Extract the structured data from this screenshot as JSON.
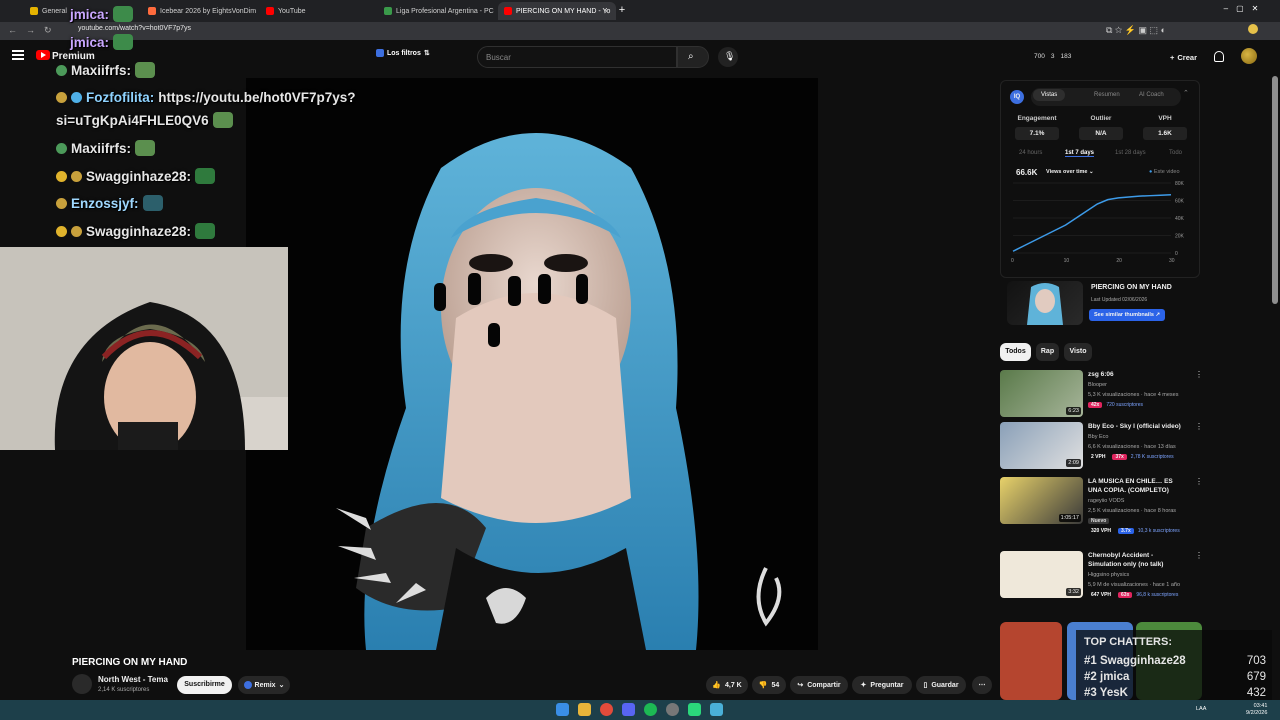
{
  "browser": {
    "tabs": [
      {
        "label": "General",
        "active": false
      },
      {
        "label": "Icebear 2026 by EightsVonDim",
        "active": false
      },
      {
        "label": "YouTube",
        "active": false
      },
      {
        "label": "Liga Profesional Argentina - PC",
        "active": false
      },
      {
        "label": "PIERCING ON MY HAND - Yo",
        "active": true
      }
    ],
    "url": "youtube.com/watch?v=hot0VF7p7ys"
  },
  "header": {
    "premium_label": "Premium",
    "filters_label": "Los filtros",
    "search_placeholder": "Buscar",
    "stats": [
      "700",
      "3",
      "183"
    ],
    "create_label": "Crear"
  },
  "chat": {
    "lines": [
      {
        "user": "jmica:",
        "msg": ""
      },
      {
        "user": "jmica:",
        "msg": ""
      },
      {
        "user": "Maxiifrfs:",
        "msg": ""
      },
      {
        "user": "Fozfofilita:",
        "msg": "https://youtu.be/hot0VF7p7ys?"
      },
      {
        "user": "",
        "msg": "si=uTgKpAi4FHLE0QV6"
      },
      {
        "user": "Maxiifrfs:",
        "msg": ""
      },
      {
        "user": "Swagginhaze28:",
        "msg": ""
      },
      {
        "user": "Enzossjyf:",
        "msg": ""
      },
      {
        "user": "Swagginhaze28:",
        "msg": ""
      }
    ]
  },
  "video": {
    "title": "PIERCING ON MY HAND",
    "channel": "North West - Tema",
    "subscribers": "2,14 K suscriptores",
    "subscribe_label": "Suscribirme",
    "remix_label": "Remix",
    "likes": "4,7 K",
    "dislikes": "54",
    "share_label": "Compartir",
    "ask_label": "Preguntar",
    "save_label": "Guardar"
  },
  "vidiq": {
    "logo": "IQ",
    "tabs": [
      "Vistas",
      "Resumen",
      "AI Coach"
    ],
    "metrics": [
      {
        "label": "Engagement",
        "value": "7.1%"
      },
      {
        "label": "Outlier",
        "value": "N/A"
      },
      {
        "label": "VPH",
        "value": "1.6K"
      }
    ],
    "periods": [
      "24 hours",
      "1st 7 days",
      "1st 28 days",
      "Todo"
    ],
    "total": "66.6K",
    "dropdown": "Views over time",
    "legend": "Este video"
  },
  "chart_data": {
    "type": "line",
    "x": [
      0,
      2,
      4,
      6,
      8,
      10,
      12,
      14,
      16,
      18,
      20,
      22,
      24,
      26,
      28,
      30
    ],
    "series": [
      {
        "values": [
          2000,
          8000,
          14000,
          20000,
          26000,
          32000,
          40000,
          48000,
          56000,
          61000,
          63000,
          64000,
          65000,
          65500,
          66000,
          66600
        ]
      }
    ],
    "xticks": [
      "0",
      "10",
      "20",
      "30"
    ],
    "yticks": [
      "0",
      "20K",
      "40K",
      "60K",
      "80K"
    ],
    "ylim": [
      0,
      80000
    ]
  },
  "thumb_card": {
    "title": "PIERCING ON MY HAND",
    "sub": "Last Updated 02/06/2026",
    "button": "See similar thumbnails"
  },
  "chips": [
    "Todos",
    "Rap",
    "Visto"
  ],
  "recs": [
    {
      "title": "zsg 6:06",
      "channel": "Blooper",
      "views": "5,3 K visualizaciones · hace 4 meses",
      "duration": "6:23",
      "tag1": "42x",
      "tag2": "720 suscriptores"
    },
    {
      "title": "Bby Eco - Sky I (official video)",
      "channel": "Bby Eco",
      "views": "6,6 K visualizaciones · hace 13 días",
      "duration": "2:09",
      "tag0": "2 VPH",
      "tag1": "37x",
      "tag2": "2,78 K suscriptores"
    },
    {
      "title": "LA MUSICA EN CHILE… ES UNA COPIA. (COMPLETO)",
      "channel": "rageyiio VODS",
      "views": "2,5 K visualizaciones · hace 8 horas",
      "duration": "1:05:17",
      "new": "Nuevo",
      "tag0": "320 VPH",
      "tag1": "3.7x",
      "tag2": "10,3 k suscriptores"
    },
    {
      "title": "Chernobyl Accident - Simulation only (no talk)",
      "channel": "Higgsino physics",
      "views": "5,9 M de visualizaciones · hace 1 año",
      "duration": "3:32",
      "tag0": "647 VPH",
      "tag1": "63x",
      "tag2": "96,8 k suscriptores"
    }
  ],
  "top_chatters": {
    "heading": "TOP CHATTERS:",
    "rows": [
      {
        "rank": "#1",
        "name": "Swagginhaze28",
        "count": "703"
      },
      {
        "rank": "#2",
        "name": "jmica",
        "count": "679"
      },
      {
        "rank": "#3",
        "name": "YesK",
        "count": "432"
      }
    ]
  },
  "taskbar": {
    "lang": "LAA",
    "time": "03:41",
    "date": "9/2/2026"
  },
  "colors": {
    "accent": "#3d6fe0",
    "yt_red": "#ff0000",
    "taskbar": "#1d3f4a"
  }
}
